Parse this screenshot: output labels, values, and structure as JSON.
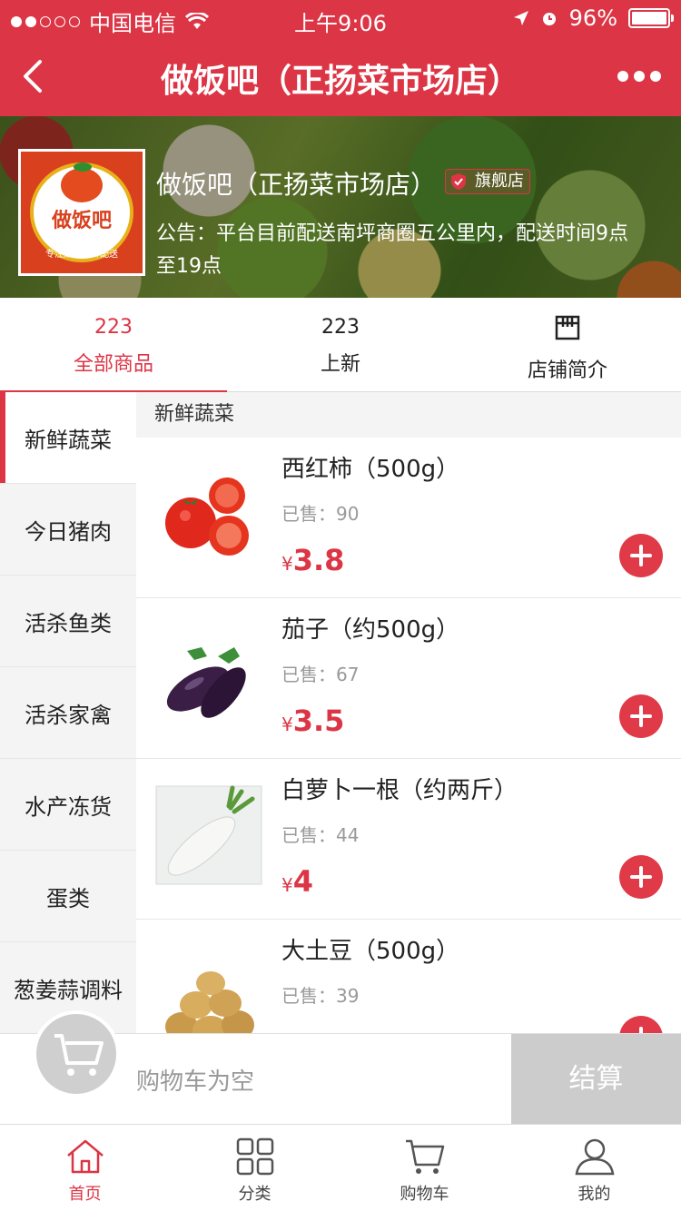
{
  "status_bar": {
    "carrier": "中国电信",
    "time": "上午9:06",
    "battery": "96%"
  },
  "nav": {
    "title": "做饭吧（正扬菜市场店）"
  },
  "shop": {
    "name": "做饭吧（正扬菜市场店）",
    "badge": "旗舰店",
    "notice": "公告：平台目前配送南坪商圈五公里内，配送时间9点至19点",
    "logo_text": "做饭吧",
    "logo_sub": "专注菜市生鲜配送"
  },
  "tabs": [
    {
      "count": "223",
      "label": "全部商品"
    },
    {
      "count": "223",
      "label": "上新"
    },
    {
      "label": "店铺简介"
    }
  ],
  "categories": [
    "新鲜蔬菜",
    "今日猪肉",
    "活杀鱼类",
    "活杀家禽",
    "水产冻货",
    "蛋类",
    "葱姜蒜调料"
  ],
  "section_title": "新鲜蔬菜",
  "products": [
    {
      "name": "西红柿（500g）",
      "sold": "已售：90",
      "currency": "¥",
      "price": "3.8"
    },
    {
      "name": "茄子（约500g）",
      "sold": "已售：67",
      "currency": "¥",
      "price": "3.5"
    },
    {
      "name": "白萝卜一根（约两斤）",
      "sold": "已售：44",
      "currency": "¥",
      "price": "4"
    },
    {
      "name": "大土豆（500g）",
      "sold": "已售：39",
      "currency": "¥",
      "price": ""
    }
  ],
  "cart": {
    "empty_text": "购物车为空",
    "checkout_label": "结算"
  },
  "tabbar": [
    {
      "label": "首页",
      "icon": "home-icon"
    },
    {
      "label": "分类",
      "icon": "grid-icon"
    },
    {
      "label": "购物车",
      "icon": "cart-icon"
    },
    {
      "label": "我的",
      "icon": "user-icon"
    }
  ],
  "colors": {
    "brand": "#dc3545",
    "price": "#dc3545",
    "checkout_disabled": "#cccccc"
  }
}
